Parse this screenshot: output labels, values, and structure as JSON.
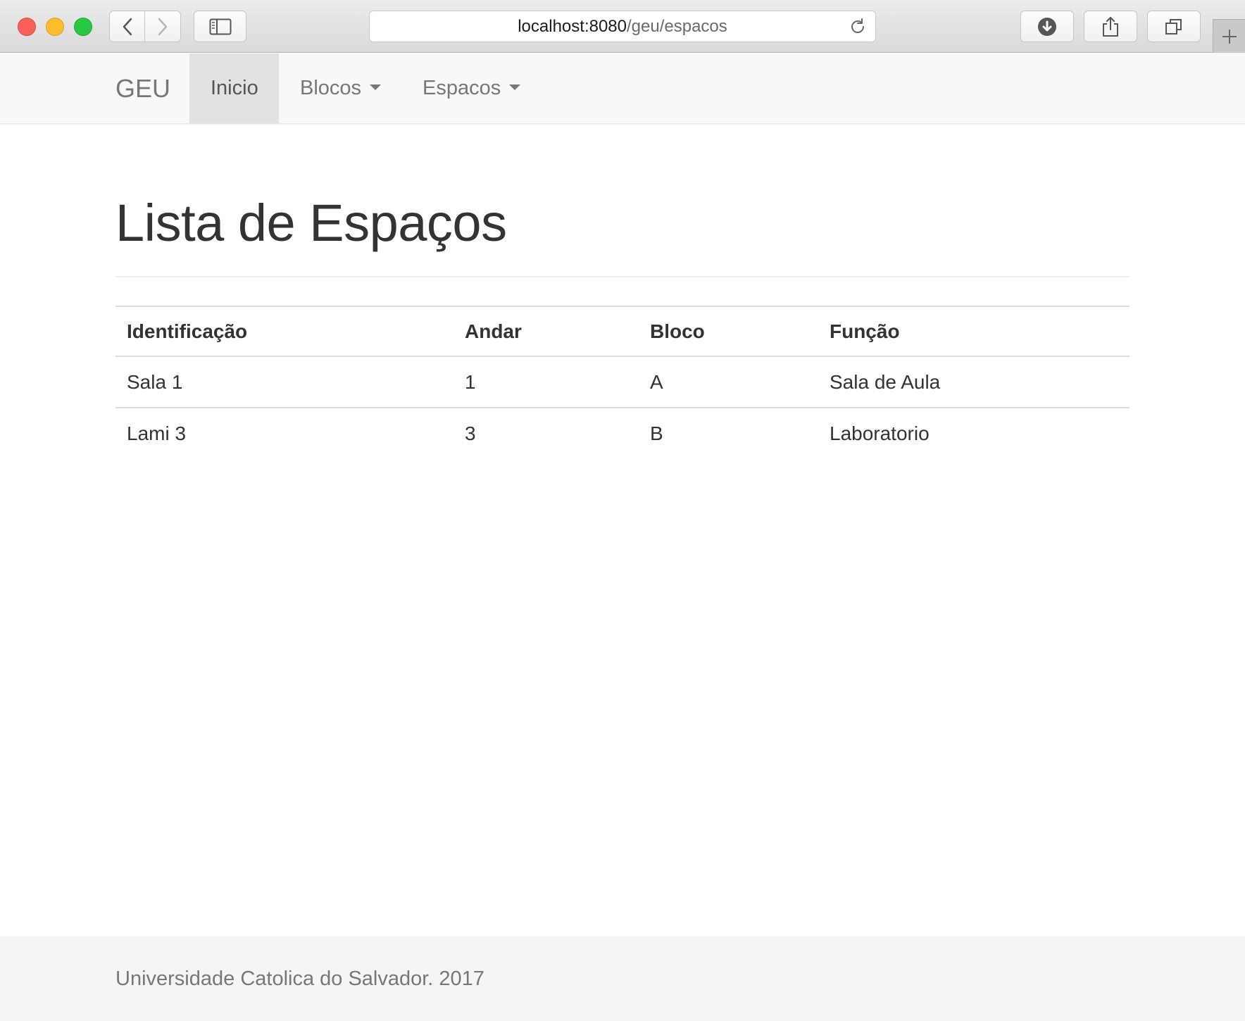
{
  "browser": {
    "url_host": "localhost:8080",
    "url_path": "/geu/espacos"
  },
  "navbar": {
    "brand": "GEU",
    "items": [
      {
        "label": "Inicio",
        "active": true,
        "dropdown": false
      },
      {
        "label": "Blocos",
        "active": false,
        "dropdown": true
      },
      {
        "label": "Espacos",
        "active": false,
        "dropdown": true
      }
    ]
  },
  "main": {
    "title": "Lista de Espaços",
    "table": {
      "headers": [
        "Identificação",
        "Andar",
        "Bloco",
        "Função"
      ],
      "rows": [
        [
          "Sala 1",
          "1",
          "A",
          "Sala de Aula"
        ],
        [
          "Lami 3",
          "3",
          "B",
          "Laboratorio"
        ]
      ]
    }
  },
  "footer": {
    "text": "Universidade Catolica do Salvador. 2017"
  },
  "colors": {
    "navbar_bg": "#f8f8f8",
    "nav_active_bg": "#e2e2e2",
    "text_primary": "#333333",
    "text_muted": "#777777",
    "footer_bg": "#f5f5f5",
    "traffic_close": "#fc5f57",
    "traffic_minimize": "#fdbc2e",
    "traffic_maximize": "#28c840"
  },
  "icons": [
    "back-arrow-icon",
    "forward-arrow-icon",
    "sidebar-icon",
    "reload-icon",
    "download-icon",
    "share-icon",
    "tabs-overview-icon",
    "plus-icon",
    "caret-down-icon"
  ]
}
